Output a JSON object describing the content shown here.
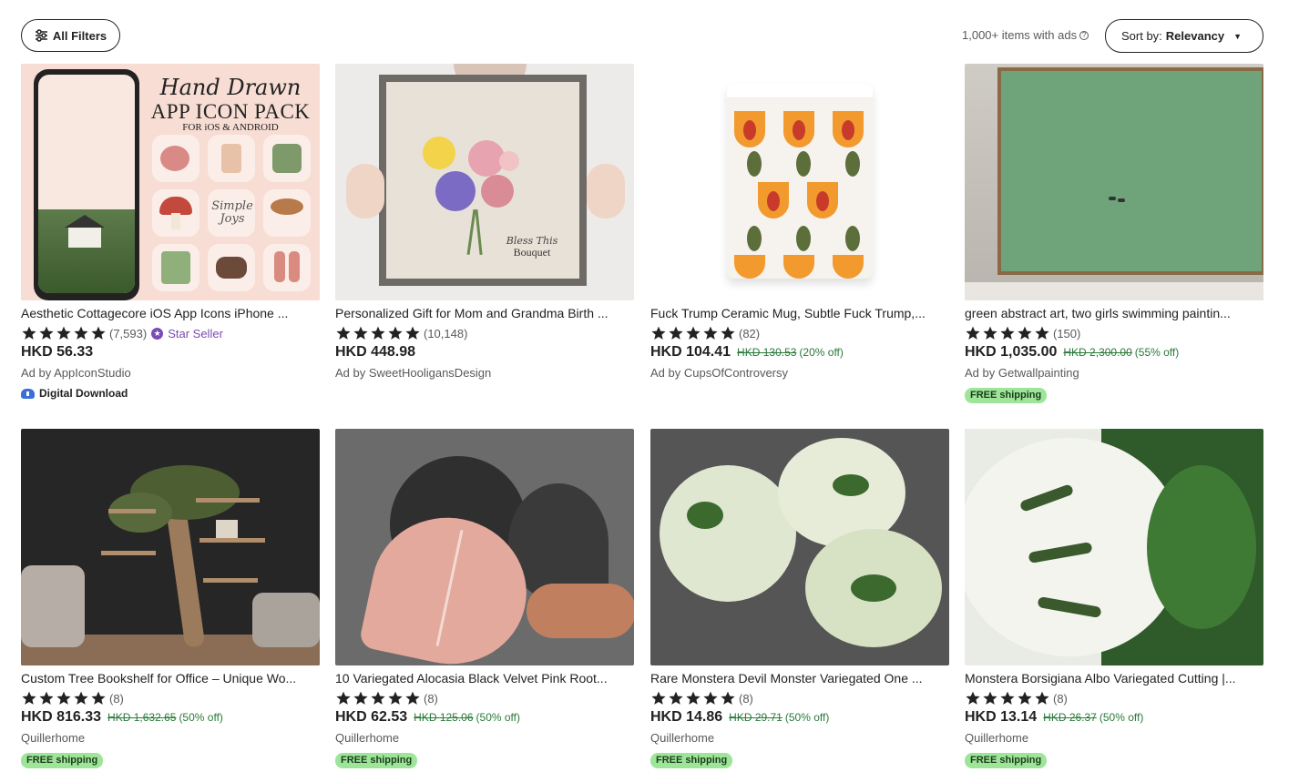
{
  "toolbar": {
    "filters_label": "All Filters",
    "items_count": "1,000+ items with ads",
    "help_glyph": "?",
    "sort_prefix": "Sort by:",
    "sort_value": "Relevancy"
  },
  "products": [
    {
      "title": "Aesthetic Cottagecore iOS App Icons iPhone ...",
      "reviews": "(7,593)",
      "star_seller": "Star Seller",
      "price": "HKD 56.33",
      "original_price": "",
      "discount": "",
      "seller": "Ad by AppIconStudio",
      "digital": "Digital Download",
      "free_shipping": "",
      "image_text": {
        "line1": "Hand Drawn",
        "line2": "APP ICON PACK",
        "line3": "FOR iOS & ANDROID",
        "tag": "Simple Joys"
      }
    },
    {
      "title": "Personalized Gift for Mom and Grandma Birth ...",
      "reviews": "(10,148)",
      "star_seller": "",
      "price": "HKD 448.98",
      "original_price": "",
      "discount": "",
      "seller": "Ad by SweetHooligansDesign",
      "digital": "",
      "free_shipping": "",
      "image_text": {
        "line1": "Bless This",
        "line2": "Bouquet"
      }
    },
    {
      "title": "Fuck Trump Ceramic Mug, Subtle Fuck Trump,...",
      "reviews": "(82)",
      "star_seller": "",
      "price": "HKD 104.41",
      "original_price": "HKD 130.53",
      "discount": "(20% off)",
      "seller": "Ad by CupsOfControversy",
      "digital": "",
      "free_shipping": ""
    },
    {
      "title": "green abstract art, two girls swimming paintin...",
      "reviews": "(150)",
      "star_seller": "",
      "price": "HKD 1,035.00",
      "original_price": "HKD 2,300.00",
      "discount": "(55% off)",
      "seller": "Ad by Getwallpainting",
      "digital": "",
      "free_shipping": "FREE shipping"
    },
    {
      "title": "Custom Tree Bookshelf for Office – Unique Wo...",
      "reviews": "(8)",
      "star_seller": "",
      "price": "HKD 816.33",
      "original_price": "HKD 1,632.65",
      "discount": "(50% off)",
      "seller": "Quillerhome",
      "digital": "",
      "free_shipping": "FREE shipping"
    },
    {
      "title": "10 Variegated Alocasia Black Velvet Pink Root...",
      "reviews": "(8)",
      "star_seller": "",
      "price": "HKD 62.53",
      "original_price": "HKD 125.06",
      "discount": "(50% off)",
      "seller": "Quillerhome",
      "digital": "",
      "free_shipping": "FREE shipping"
    },
    {
      "title": "Rare Monstera Devil Monster Variegated One ...",
      "reviews": "(8)",
      "star_seller": "",
      "price": "HKD 14.86",
      "original_price": "HKD 29.71",
      "discount": "(50% off)",
      "seller": "Quillerhome",
      "digital": "",
      "free_shipping": "FREE shipping"
    },
    {
      "title": "Monstera Borsigiana Albo Variegated Cutting |...",
      "reviews": "(8)",
      "star_seller": "",
      "price": "HKD 13.14",
      "original_price": "HKD 26.37",
      "discount": "(50% off)",
      "seller": "Quillerhome",
      "digital": "",
      "free_shipping": "FREE shipping"
    }
  ],
  "icons": {
    "filter": "sliders-icon",
    "star": "star-icon",
    "caret": "caret-down-icon",
    "digital": "cloud-download-icon"
  },
  "colors": {
    "discount_green": "#2a7a3a",
    "free_shipping_bg": "#9ee59a",
    "star_seller_purple": "#7b4ab5"
  }
}
